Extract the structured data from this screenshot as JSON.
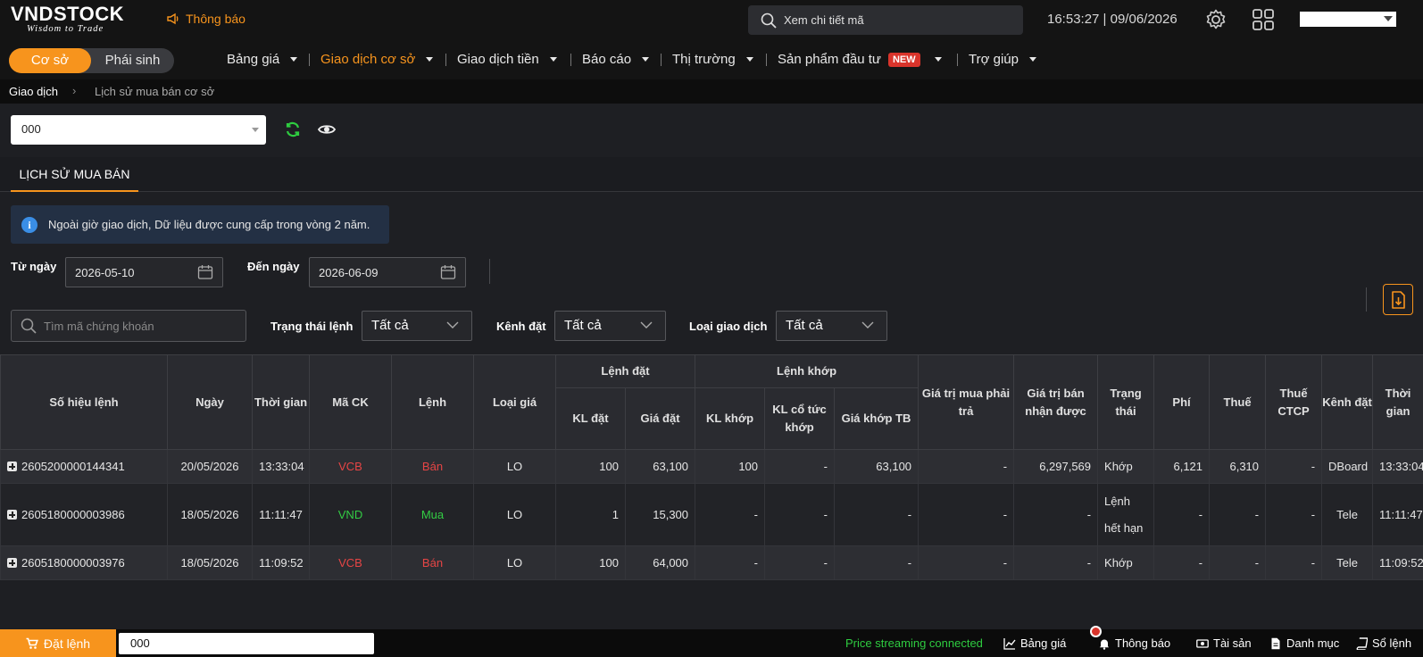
{
  "header": {
    "logo_text": "VNDSTOCK",
    "logo_slogan": "Wisdom to Trade",
    "notification_label": "Thông báo",
    "search_placeholder": "Xem chi tiết mã",
    "clock": "16:53:27 | 09/06/2026"
  },
  "nav": {
    "segment": [
      "Cơ sở",
      "Phái sinh"
    ],
    "menus": [
      "Bảng giá",
      "Giao dịch cơ sở",
      "Giao dịch tiền",
      "Báo cáo",
      "Thị trường",
      "Sản phẩm đầu tư",
      "Trợ giúp"
    ],
    "new_badge": "NEW"
  },
  "breadcrumb": [
    "Giao dịch",
    "Lịch sử mua bán cơ sở"
  ],
  "account_value": "000",
  "tab": "LỊCH SỬ MUA BÁN",
  "info_text": "Ngoài giờ giao dịch, Dữ liệu được cung cấp trong vòng 2 năm.",
  "filters": {
    "from_label": "Từ ngày",
    "from_value": "2026-05-10",
    "to_label": "Đến ngày",
    "to_value": "2026-06-09",
    "search_placeholder": "Tìm mã chứng khoán",
    "status_label": "Trạng thái lệnh",
    "status_value": "Tất cả",
    "channel_label": "Kênh đặt",
    "channel_value": "Tất cả",
    "type_label": "Loại giao dịch",
    "type_value": "Tất cả"
  },
  "table": {
    "headers": {
      "order_id": "Số hiệu lệnh",
      "date": "Ngày",
      "time": "Thời gian",
      "symbol": "Mã CK",
      "side": "Lệnh",
      "price_type": "Loại giá",
      "placed_group": "Lệnh đặt",
      "placed_qty": "KL đặt",
      "placed_price": "Giá đặt",
      "matched_group": "Lệnh khớp",
      "matched_qty": "KL khớp",
      "dividend_qty": "KL cổ tức khớp",
      "avg_price": "Giá khớp TB",
      "buy_value": "Giá trị mua phải trả",
      "sell_value": "Giá trị bán nhận được",
      "status": "Trạng thái",
      "fee": "Phí",
      "tax": "Thuế",
      "tax_ctcp": "Thuế CTCP",
      "channel": "Kênh đặt",
      "order_time": "Thời gian"
    },
    "rows": [
      {
        "order_id": "2605200000144341",
        "date": "20/05/2026",
        "time": "13:33:04",
        "symbol": "VCB",
        "side": "Bán",
        "price_type": "LO",
        "placed_qty": "100",
        "placed_price": "63,100",
        "matched_qty": "100",
        "dividend_qty": "-",
        "avg_price": "63,100",
        "buy_value": "-",
        "sell_value": "6,297,569",
        "status": "Khớp",
        "fee": "6,121",
        "tax": "6,310",
        "tax_ctcp": "-",
        "channel": "DBoard",
        "order_time": "13:33:04"
      },
      {
        "order_id": "2605180000003986",
        "date": "18/05/2026",
        "time": "11:11:47",
        "symbol": "VND",
        "side": "Mua",
        "price_type": "LO",
        "placed_qty": "1",
        "placed_price": "15,300",
        "matched_qty": "-",
        "dividend_qty": "-",
        "avg_price": "-",
        "buy_value": "-",
        "sell_value": "-",
        "status": "Lệnh hết hạn",
        "fee": "-",
        "tax": "-",
        "tax_ctcp": "-",
        "channel": "Tele",
        "order_time": "11:11:47"
      },
      {
        "order_id": "2605180000003976",
        "date": "18/05/2026",
        "time": "11:09:52",
        "symbol": "VCB",
        "side": "Bán",
        "price_type": "LO",
        "placed_qty": "100",
        "placed_price": "64,000",
        "matched_qty": "-",
        "dividend_qty": "-",
        "avg_price": "-",
        "buy_value": "-",
        "sell_value": "-",
        "status": "Khớp",
        "fee": "-",
        "tax": "-",
        "tax_ctcp": "-",
        "channel": "Tele",
        "order_time": "11:09:52"
      }
    ]
  },
  "bottom": {
    "order_button": "Đặt lệnh",
    "input_value": "000",
    "stream_status": "Price streaming connected",
    "items": [
      "Bảng giá",
      "Thông báo",
      "Tài sản",
      "Danh mục",
      "Sổ lệnh"
    ]
  },
  "colors": {
    "accent": "#f7941d",
    "sell": "#e64545",
    "buy": "#33cc44",
    "new_badge": "#d9342b"
  }
}
